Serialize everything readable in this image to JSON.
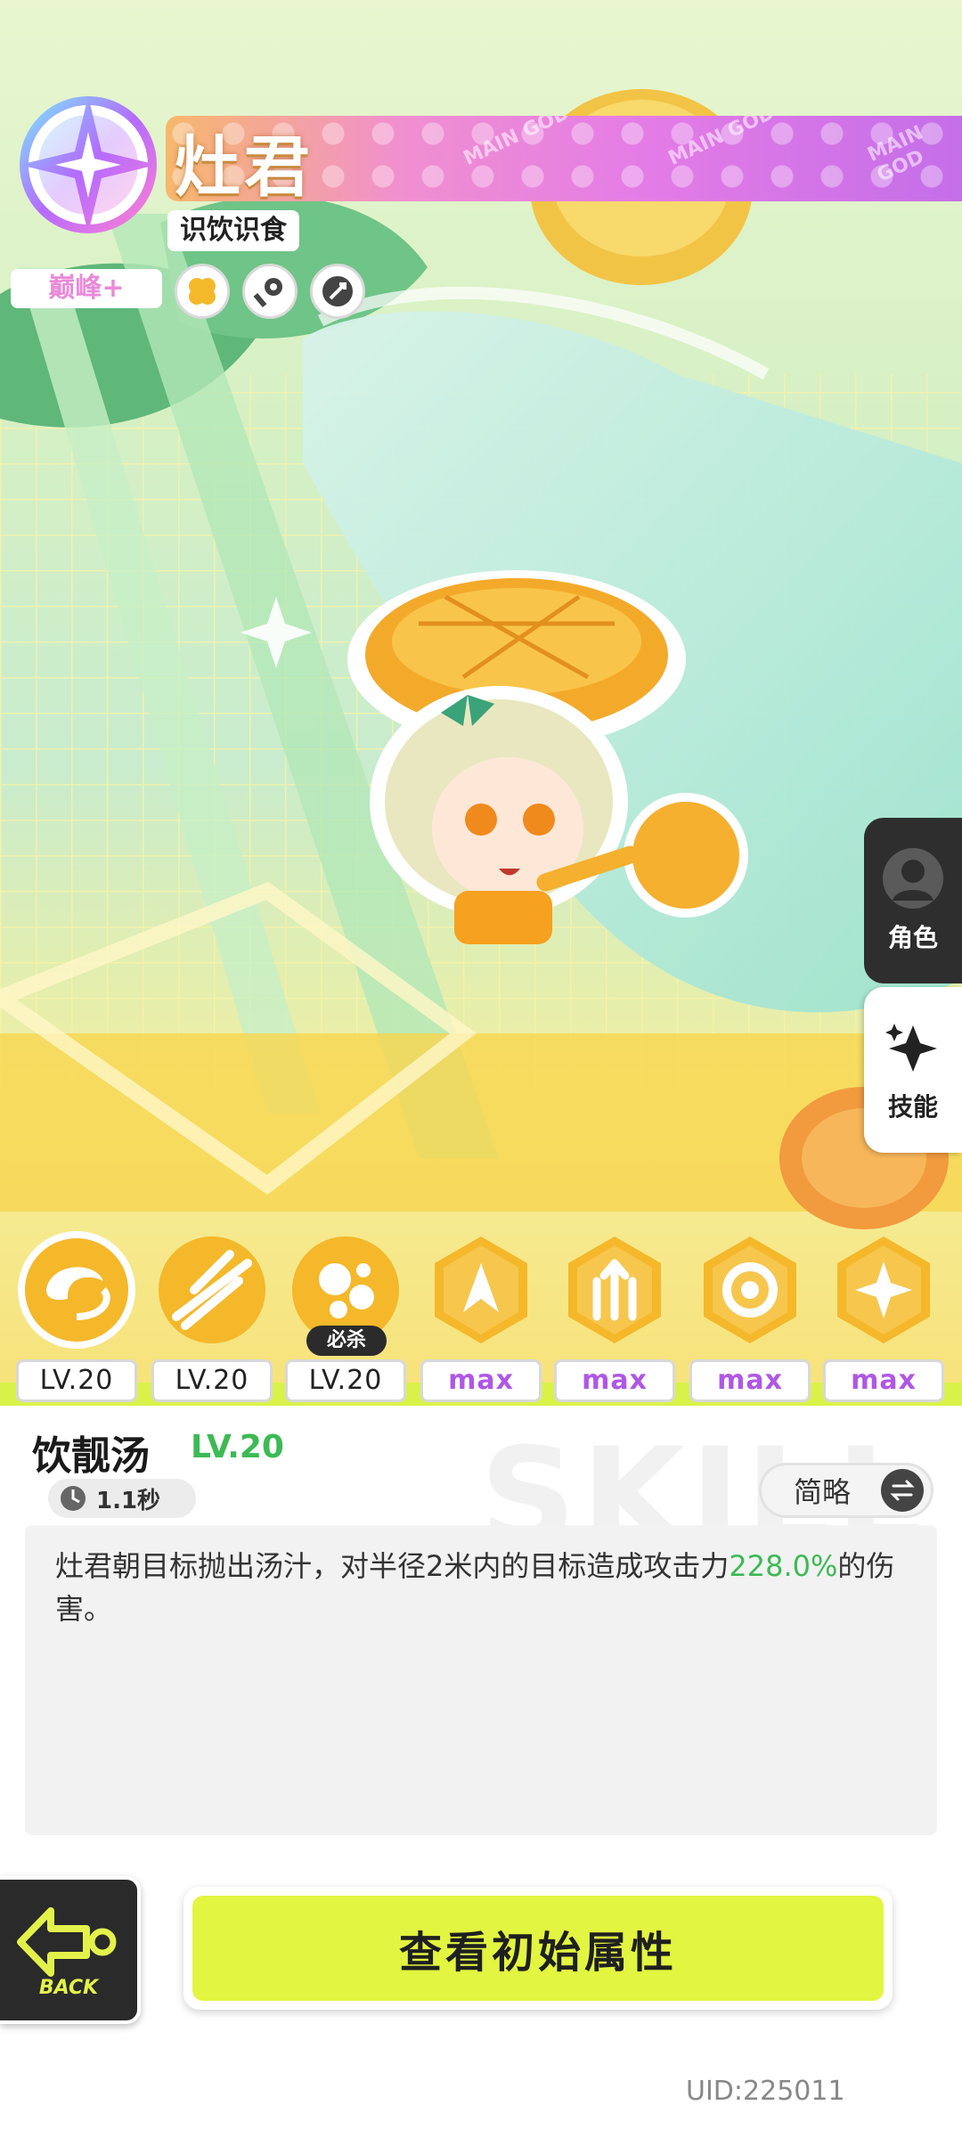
{
  "header": {
    "character_name": "灶君",
    "character_title": "识饮识食",
    "rank": "巅峰+",
    "trait_icons": [
      "clover-icon",
      "key-icon",
      "sword-badge-icon"
    ]
  },
  "side_tabs": [
    {
      "label": "角色",
      "icon": "person-avatar-icon",
      "active": false
    },
    {
      "label": "技能",
      "icon": "sparkle-star-icon",
      "active": true
    }
  ],
  "skills": [
    {
      "icon": "swirl-skill-icon",
      "level": "LV.20"
    },
    {
      "icon": "slash-skill-icon",
      "level": "LV.20"
    },
    {
      "icon": "bubbles-skill-icon",
      "level": "LV.20",
      "badge": "必杀"
    },
    {
      "icon": "flame-burst-icon",
      "level": "max"
    },
    {
      "icon": "triple-arrow-icon",
      "level": "max"
    },
    {
      "icon": "vortex-icon",
      "level": "max"
    },
    {
      "icon": "spin-star-icon",
      "level": "max"
    }
  ],
  "detail": {
    "skill_name": "饮靓汤",
    "skill_level": "LV.20",
    "cooldown": "1.1秒",
    "toggle_label": "简略",
    "watermark": "SKILL",
    "description_before": "灶君朝目标抛出汤汁，对半径2米内的目标造成攻击力",
    "description_highlight": "228.0%",
    "description_after": "的伤害。"
  },
  "buttons": {
    "back_label": "BACK",
    "view_attributes_label": "查看初始属性"
  },
  "footer": {
    "uid": "UID:225011"
  },
  "colors": {
    "accent_lime": "#e2f540",
    "level_green": "#3dba55",
    "max_purple": "#b057e6",
    "skill_gold": "#f4b82a"
  }
}
